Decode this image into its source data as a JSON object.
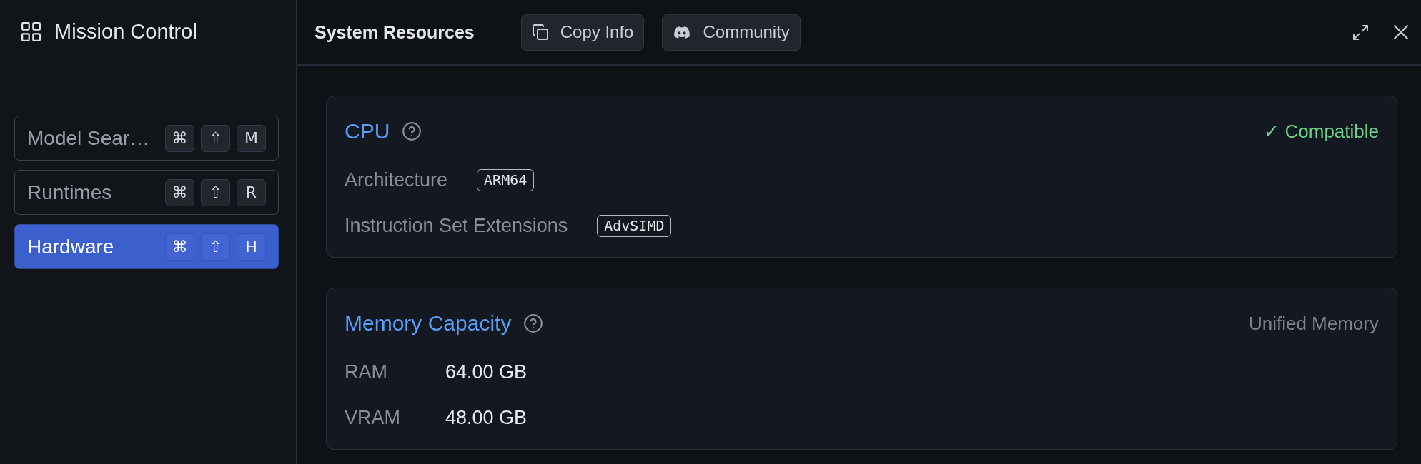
{
  "sidebar": {
    "title": "Mission Control",
    "items": [
      {
        "label": "Model Sear…",
        "selected": false,
        "keys": [
          "⌘",
          "⇧",
          "M"
        ]
      },
      {
        "label": "Runtimes",
        "selected": false,
        "keys": [
          "⌘",
          "⇧",
          "R"
        ]
      },
      {
        "label": "Hardware",
        "selected": true,
        "keys": [
          "⌘",
          "⇧",
          "H"
        ]
      }
    ]
  },
  "header": {
    "title": "System Resources",
    "buttons": [
      {
        "label": "Copy Info",
        "kind": "copy"
      },
      {
        "label": "Community",
        "kind": "chat"
      }
    ]
  },
  "sections": [
    {
      "title": "CPU",
      "aside": {
        "kind": "success",
        "text": "✓ Compatible"
      },
      "rows": [
        {
          "label": "Architecture",
          "value": "ARM64",
          "kind": "tag"
        },
        {
          "label": "Instruction Set Extensions",
          "value": "AdvSIMD",
          "kind": "tag"
        }
      ]
    },
    {
      "title": "Memory Capacity",
      "aside": {
        "kind": "muted",
        "text": "Unified Memory"
      },
      "rows": [
        {
          "label": "RAM",
          "value": "64.00 GB",
          "kind": "plain"
        },
        {
          "label": "VRAM",
          "value": "48.00 GB",
          "kind": "plain"
        }
      ]
    }
  ]
}
